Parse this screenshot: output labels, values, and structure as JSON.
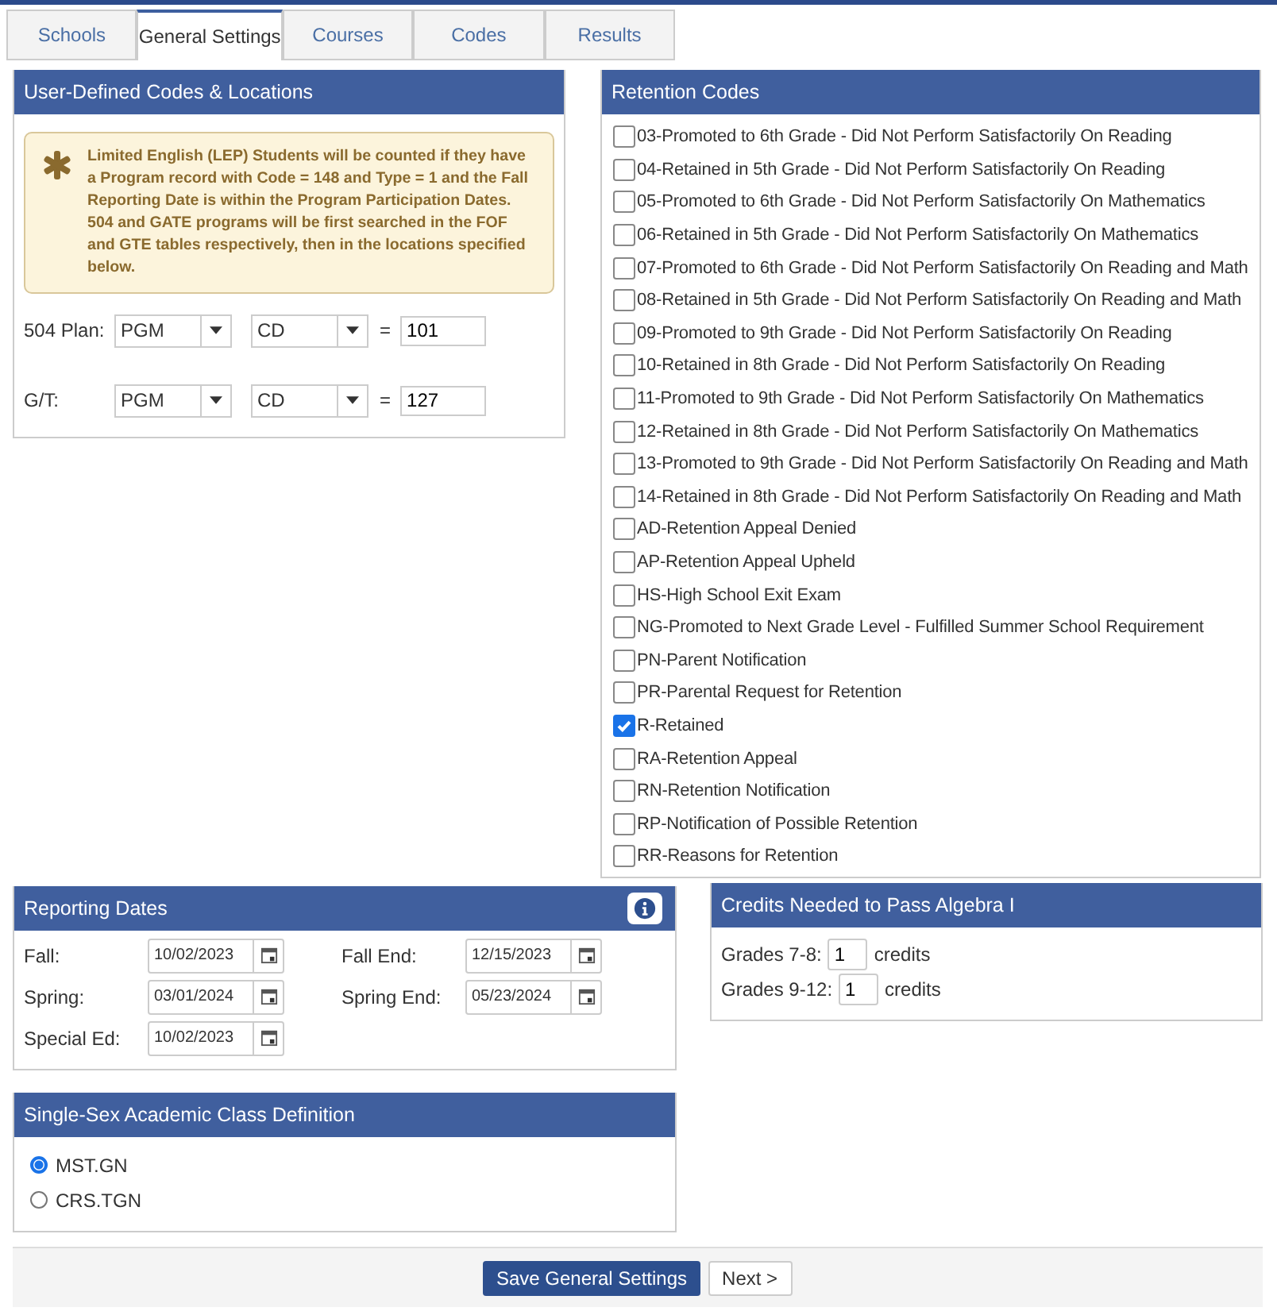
{
  "tabs": [
    {
      "label": "Schools",
      "selected": false
    },
    {
      "label": "General Settings",
      "selected": true
    },
    {
      "label": "Courses",
      "selected": false
    },
    {
      "label": "Codes",
      "selected": false
    },
    {
      "label": "Results",
      "selected": false
    }
  ],
  "user_defined": {
    "title": "User-Defined Codes & Locations",
    "note": "Limited English (LEP) Students will be counted if they have a Program record with Code = 148 and Type = 1 and the Fall Reporting Date is within the Program Participation Dates. 504 and GATE programs will be first searched in the FOF and GTE tables respectively, then in the locations specified below.",
    "rows": [
      {
        "label": "504 Plan:",
        "table": "PGM",
        "field": "CD",
        "operator": "=",
        "value": "101"
      },
      {
        "label": "G/T:",
        "table": "PGM",
        "field": "CD",
        "operator": "=",
        "value": "127"
      }
    ]
  },
  "retention": {
    "title": "Retention Codes",
    "codes": [
      {
        "label": "03-Promoted to 6th Grade - Did Not Perform Satisfactorily On Reading",
        "checked": false
      },
      {
        "label": "04-Retained in 5th Grade - Did Not Perform Satisfactorily On Reading",
        "checked": false
      },
      {
        "label": "05-Promoted to 6th Grade - Did Not Perform Satisfactorily On Mathematics",
        "checked": false
      },
      {
        "label": "06-Retained in 5th Grade - Did Not Perform Satisfactorily On Mathematics",
        "checked": false
      },
      {
        "label": "07-Promoted to 6th Grade - Did Not Perform Satisfactorily On Reading and Math",
        "checked": false
      },
      {
        "label": "08-Retained in 5th Grade - Did Not Perform Satisfactorily On Reading and Math",
        "checked": false
      },
      {
        "label": "09-Promoted to 9th Grade - Did Not Perform Satisfactorily On Reading",
        "checked": false
      },
      {
        "label": "10-Retained in 8th Grade - Did Not Perform Satisfactorily On Reading",
        "checked": false
      },
      {
        "label": "11-Promoted to 9th Grade - Did Not Perform Satisfactorily On Mathematics",
        "checked": false
      },
      {
        "label": "12-Retained in 8th Grade - Did Not Perform Satisfactorily On Mathematics",
        "checked": false
      },
      {
        "label": "13-Promoted to 9th Grade - Did Not Perform Satisfactorily On Reading and Math",
        "checked": false
      },
      {
        "label": "14-Retained in 8th Grade - Did Not Perform Satisfactorily On Reading and Math",
        "checked": false
      },
      {
        "label": "AD-Retention Appeal Denied",
        "checked": false
      },
      {
        "label": "AP-Retention Appeal Upheld",
        "checked": false
      },
      {
        "label": "HS-High School Exit Exam",
        "checked": false
      },
      {
        "label": "NG-Promoted to Next Grade Level - Fulfilled Summer School Requirement",
        "checked": false
      },
      {
        "label": "PN-Parent Notification",
        "checked": false
      },
      {
        "label": "PR-Parental Request for Retention",
        "checked": false
      },
      {
        "label": "R-Retained",
        "checked": true
      },
      {
        "label": "RA-Retention Appeal",
        "checked": false
      },
      {
        "label": "RN-Retention Notification",
        "checked": false
      },
      {
        "label": "RP-Notification of Possible Retention",
        "checked": false
      },
      {
        "label": "RR-Reasons for Retention",
        "checked": false
      }
    ]
  },
  "reporting_dates": {
    "title": "Reporting Dates",
    "fields": [
      {
        "label": "Fall:",
        "value": "10/02/2023"
      },
      {
        "label": "Fall End:",
        "value": "12/15/2023"
      },
      {
        "label": "Spring:",
        "value": "03/01/2024"
      },
      {
        "label": "Spring End:",
        "value": "05/23/2024"
      },
      {
        "label": "Special Ed:",
        "value": "10/02/2023"
      }
    ]
  },
  "credits": {
    "title": "Credits Needed to Pass Algebra I",
    "rows": [
      {
        "label": "Grades 7-8:",
        "value": "1",
        "unit": "credits"
      },
      {
        "label": "Grades 9-12:",
        "value": "1",
        "unit": "credits"
      }
    ]
  },
  "single_sex": {
    "title": "Single-Sex Academic Class Definition",
    "options": [
      {
        "label": "MST.GN",
        "selected": true
      },
      {
        "label": "CRS.TGN",
        "selected": false
      }
    ]
  },
  "footer": {
    "primary": "Save General Settings",
    "secondary": "Next >"
  }
}
